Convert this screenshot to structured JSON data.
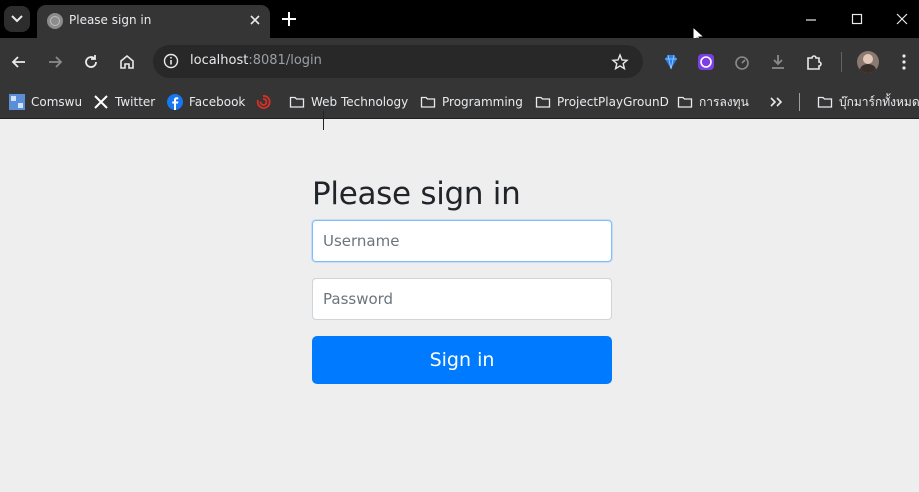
{
  "browser": {
    "tab": {
      "title": "Please sign in"
    },
    "address_bar": {
      "host": "localhost",
      "rest": ":8081/login"
    },
    "bookmarks": [
      {
        "label": "Comswu",
        "icon": "comswu-favicon-icon"
      },
      {
        "label": "Twitter",
        "icon": "x-logo-icon"
      },
      {
        "label": "Facebook",
        "icon": "facebook-logo-icon"
      },
      {
        "label": "",
        "icon": "red-swirl-favicon-icon"
      },
      {
        "label": "Web Technology",
        "icon": "folder-icon"
      },
      {
        "label": "Programming",
        "icon": "folder-icon"
      },
      {
        "label": "ProjectPlayGrounD",
        "icon": "folder-icon"
      },
      {
        "label": "การลงทุน",
        "icon": "folder-icon"
      },
      {
        "label": "บุ๊กมาร์กทั้งหมด",
        "icon": "folder-icon"
      }
    ],
    "colors": {
      "titlebar": "#000000",
      "toolbar": "#353535",
      "omnibox": "#282828"
    }
  },
  "page": {
    "heading": "Please sign in",
    "username": {
      "placeholder": "Username",
      "value": ""
    },
    "password": {
      "placeholder": "Password",
      "value": ""
    },
    "submit_label": "Sign in",
    "colors": {
      "background": "#eeeeee",
      "primary": "#007bff",
      "text": "#212529"
    }
  }
}
